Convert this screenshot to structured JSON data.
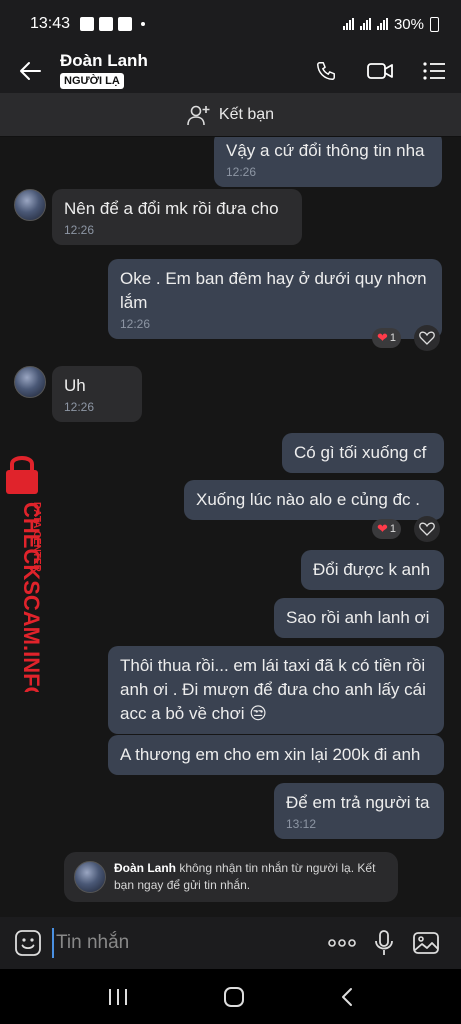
{
  "status_bar": {
    "time": "13:43",
    "battery": "30%"
  },
  "header": {
    "name": "Đoàn Lanh",
    "badge": "NGƯỜI LẠ"
  },
  "add_friend": {
    "label": "Kết bạn"
  },
  "messages": [
    {
      "dir": "out",
      "text": "Vậy a cứ đổi thông tin nha",
      "time": "12:26"
    },
    {
      "dir": "in",
      "text": "Nên để a đổi mk rồi đưa cho",
      "time": "12:26"
    },
    {
      "dir": "out",
      "text": "Oke . Em ban đêm hay ở dưới quy nhơn lắm",
      "time": "12:26",
      "reaction_count": "1"
    },
    {
      "dir": "in",
      "text": "Uh",
      "time": "12:26"
    },
    {
      "dir": "out",
      "text": "Có gì tối xuống cf"
    },
    {
      "dir": "out",
      "text": "Xuống lúc nào alo e củng đc .",
      "reaction_count": "1"
    },
    {
      "dir": "out",
      "text": "Đổi được k anh"
    },
    {
      "dir": "out",
      "text": "Sao rồi anh lanh ơi"
    },
    {
      "dir": "out",
      "text": "Thôi thua rồi... em lái taxi đã k có tiền rồi anh ơi . Đi mượn để đưa cho anh lấy cái acc a bỏ về chơi 😒"
    },
    {
      "dir": "out",
      "text": "A thương em cho em xin lại 200k đi anh"
    },
    {
      "dir": "out",
      "text": "Để em trả người ta",
      "time": "13:12"
    }
  ],
  "watermark": {
    "line1": "DATA CENTER",
    "line2": "CHECKSCAM.INFO"
  },
  "notice": {
    "name": "Đoàn Lanh",
    "text": " không nhận tin nhắn từ người lạ. Kết bạn ngay để gửi tin nhắn."
  },
  "input": {
    "placeholder": "Tin nhắn"
  },
  "colors": {
    "outgoing_bubble": "#3a4251",
    "incoming_bubble": "#2c2c2e",
    "watermark_red": "#e0232b"
  },
  "icons": [
    "back-arrow-icon",
    "phone-icon",
    "video-call-icon",
    "menu-icon",
    "add-friend-icon",
    "heart-icon",
    "emoji-icon",
    "more-icon",
    "microphone-icon",
    "image-icon",
    "recent-apps-icon",
    "home-icon",
    "nav-back-icon"
  ]
}
